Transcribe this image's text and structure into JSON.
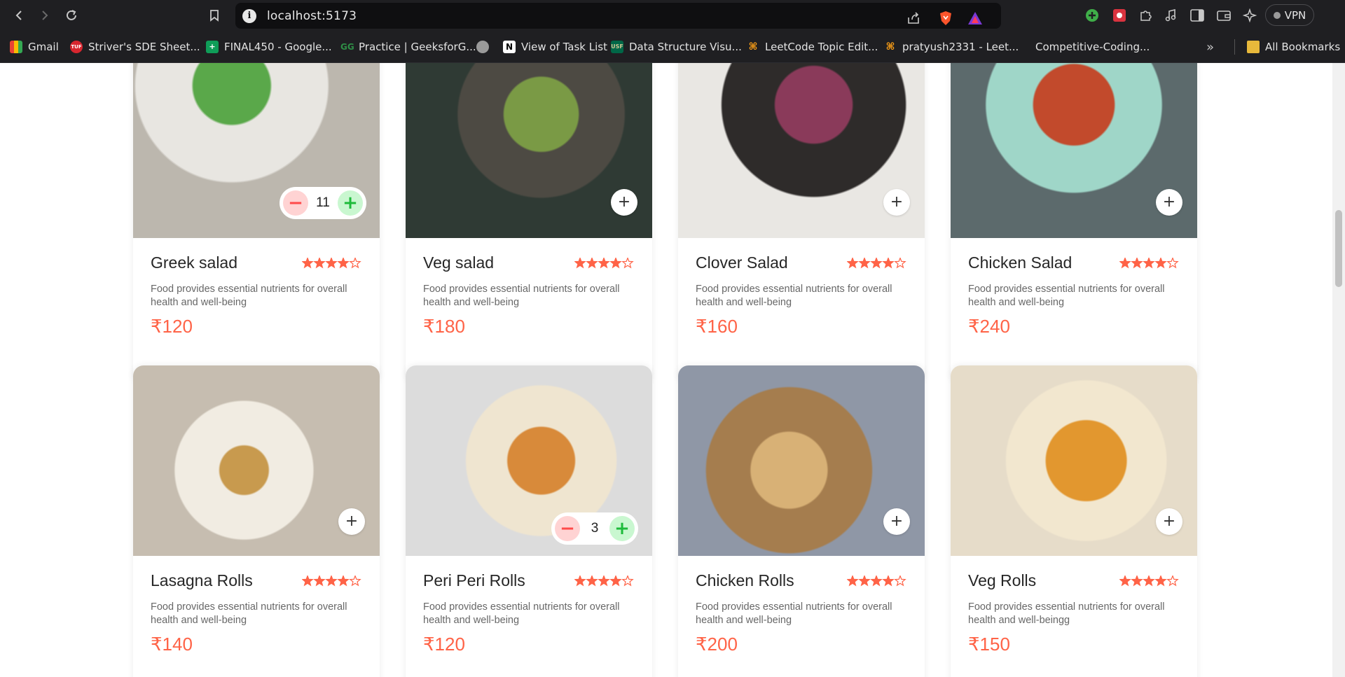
{
  "browser": {
    "url": "localhost:5173",
    "vpn_label": "VPN",
    "bookmarks": [
      {
        "label": "Gmail",
        "icon": "gmail-icon"
      },
      {
        "label": "Striver's SDE Sheet...",
        "icon": "tuf-icon"
      },
      {
        "label": "FINAL450 - Google...",
        "icon": "sheets-icon"
      },
      {
        "label": "Practice | GeeksforG...",
        "icon": "gfg-icon"
      },
      {
        "label": "",
        "icon": "globe-icon"
      },
      {
        "label": "View of Task List",
        "icon": "notion-icon"
      },
      {
        "label": "Data Structure Visu...",
        "icon": "usf-icon"
      },
      {
        "label": "LeetCode Topic Edit...",
        "icon": "leetcode-icon"
      },
      {
        "label": "pratyush2331 - Leet...",
        "icon": "leetcode-icon"
      },
      {
        "label": "Competitive-Coding...",
        "icon": ""
      }
    ],
    "all_bookmarks_label": "All Bookmarks"
  },
  "food_cards": [
    {
      "name": "Greek salad",
      "description": "Food provides essential nutrients for overall health and well-being",
      "price": "₹120",
      "rating": 4,
      "quantity": "11"
    },
    {
      "name": "Veg salad",
      "description": "Food provides essential nutrients for overall health and well-being",
      "price": "₹180",
      "rating": 4,
      "quantity": null
    },
    {
      "name": "Clover Salad",
      "description": "Food provides essential nutrients for overall health and well-being",
      "price": "₹160",
      "rating": 4,
      "quantity": null
    },
    {
      "name": "Chicken Salad",
      "description": "Food provides essential nutrients for overall health and well-being",
      "price": "₹240",
      "rating": 4,
      "quantity": null
    },
    {
      "name": "Lasagna Rolls",
      "description": "Food provides essential nutrients for overall health and well-being",
      "price": "₹140",
      "rating": 4,
      "quantity": null
    },
    {
      "name": "Peri Peri Rolls",
      "description": "Food provides essential nutrients for overall health and well-being",
      "price": "₹120",
      "rating": 4,
      "quantity": "3"
    },
    {
      "name": "Chicken Rolls",
      "description": "Food provides essential nutrients for overall health and well-being",
      "price": "₹200",
      "rating": 4,
      "quantity": null
    },
    {
      "name": "Veg Rolls",
      "description": "Food provides essential nutrients for overall health and well-beingg",
      "price": "₹150",
      "rating": 4,
      "quantity": null
    }
  ],
  "colors": {
    "accent": "#ff6347",
    "star": "#ff6347"
  }
}
